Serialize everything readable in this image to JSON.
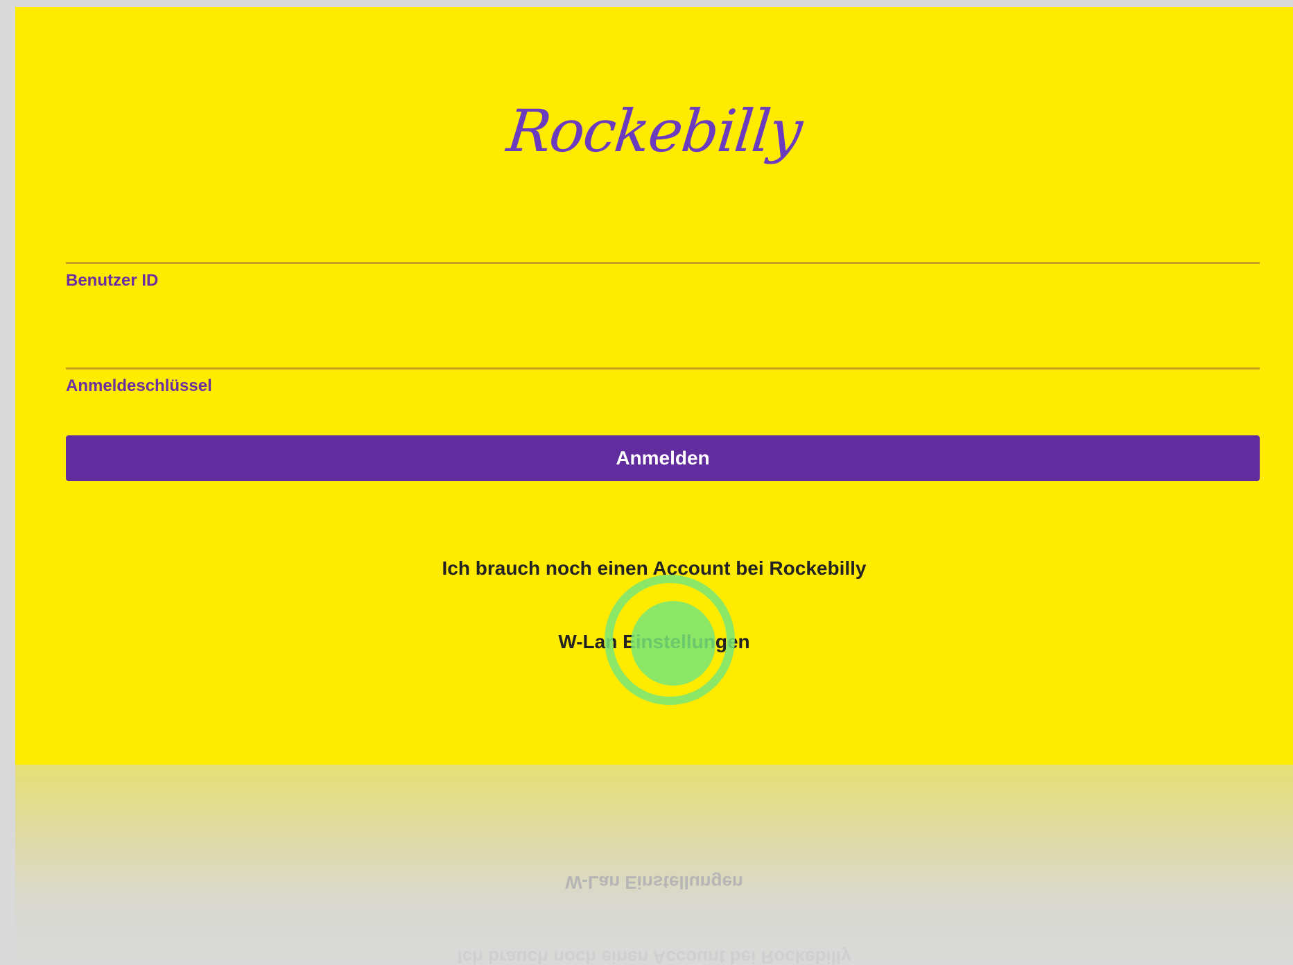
{
  "app": {
    "logo_text": "Rockebilly"
  },
  "login": {
    "user_label": "Benutzer ID",
    "password_label": "Anmeldeschlüssel",
    "submit_label": "Anmelden"
  },
  "links": {
    "register": "Ich brauch noch einen Account bei Rockebilly",
    "wlan": "W-Lan Einstellungen"
  },
  "reflection": {
    "wlan": "W-Lan Einstellungen",
    "register": "Ich brauch noch einen Account bei Rockebilly"
  },
  "colors": {
    "background": "#ffeb00",
    "accent": "#612c9e",
    "label": "#6a2fa0",
    "underline": "#c9a21a",
    "tap_indicator": "#78e678"
  },
  "icons": {
    "tap": "tap-indicator"
  }
}
